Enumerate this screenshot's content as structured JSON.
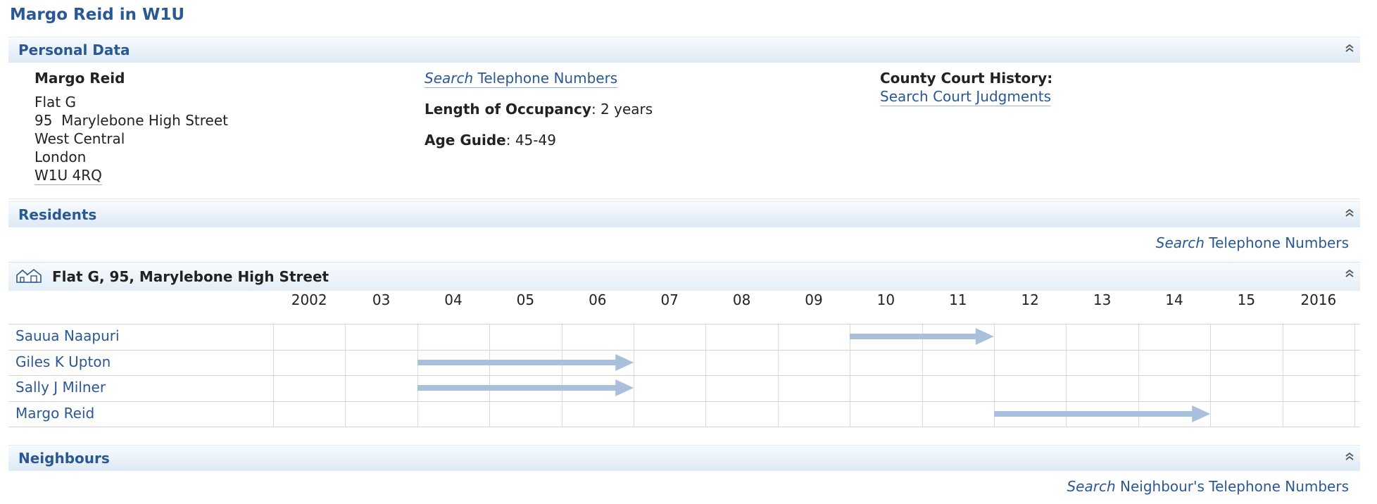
{
  "page_title": "Margo Reid in W1U",
  "personal": {
    "section_title": "Personal Data",
    "name": "Margo Reid",
    "address_lines": [
      "Flat G",
      "95  Marylebone High Street",
      "West Central",
      "London"
    ],
    "postcode": "W1U 4RQ",
    "search_phone_em": "Search",
    "search_phone_rest": " Telephone Numbers",
    "occupancy_label": "Length of Occupancy",
    "occupancy_value": ": 2 years",
    "age_label": "Age Guide",
    "age_value": ": 45-49",
    "court_label": "County Court History:",
    "court_link": "Search Court Judgments"
  },
  "residents": {
    "section_title": "Residents",
    "search_em": "Search",
    "search_rest": " Telephone Numbers",
    "address": "Flat G, 95, Marylebone High Street",
    "years": [
      "2002",
      "03",
      "04",
      "05",
      "06",
      "07",
      "08",
      "09",
      "10",
      "11",
      "12",
      "13",
      "14",
      "15",
      "2016"
    ],
    "people": [
      {
        "name": "Sauua Naapuri",
        "from": 2010,
        "to": 2012
      },
      {
        "name": "Giles K Upton",
        "from": 2004,
        "to": 2007
      },
      {
        "name": "Sally J Milner",
        "from": 2004,
        "to": 2007
      },
      {
        "name": "Margo Reid",
        "from": 2012,
        "to": 2015
      }
    ]
  },
  "neighbours": {
    "section_title": "Neighbours",
    "search_em": "Search",
    "search_rest": " Neighbour's Telephone Numbers"
  },
  "colors": {
    "accent": "#2a5894",
    "arrow": "#a9c0dd"
  },
  "icons": {
    "collapse": "double-chevron-up-icon",
    "house": "houses-icon"
  }
}
